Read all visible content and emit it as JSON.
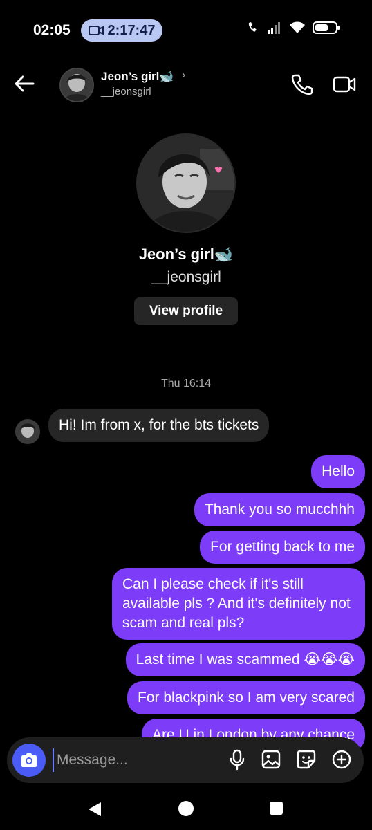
{
  "status": {
    "time": "02:05",
    "call_timer": "2:17:47"
  },
  "header": {
    "name": "Jeon’s girl🐋",
    "username": "__jeonsgirl",
    "chevron": "›"
  },
  "profile": {
    "name": "Jeon’s girl🐋",
    "username": "__jeonsgirl",
    "view_profile_label": "View profile"
  },
  "thread": {
    "timestamp": "Thu 16:14",
    "incoming": [
      "Hi! Im from x, for the bts tickets"
    ],
    "outgoing": [
      "Hello",
      "Thank you so mucchhh",
      "For getting back to me",
      "Can I please check if it's still available pls ? And it's definitely not scam and real pls?",
      "Last time I was scammed 😭😭😭",
      "For blackpink so I am very scared",
      "Are U in London by any chance"
    ]
  },
  "composer": {
    "placeholder": "Message..."
  },
  "icons": {
    "back": "arrow-left-icon",
    "phone": "phone-icon",
    "video": "video-camera-icon",
    "camera": "camera-icon",
    "mic": "microphone-icon",
    "gallery": "image-icon",
    "sticker": "sticker-icon",
    "add": "plus-circle-icon"
  },
  "colors": {
    "outgoing_bubble": "#7d3cf7",
    "incoming_bubble": "#262626",
    "camera_button": "#4a5cf5",
    "background": "#000000"
  }
}
